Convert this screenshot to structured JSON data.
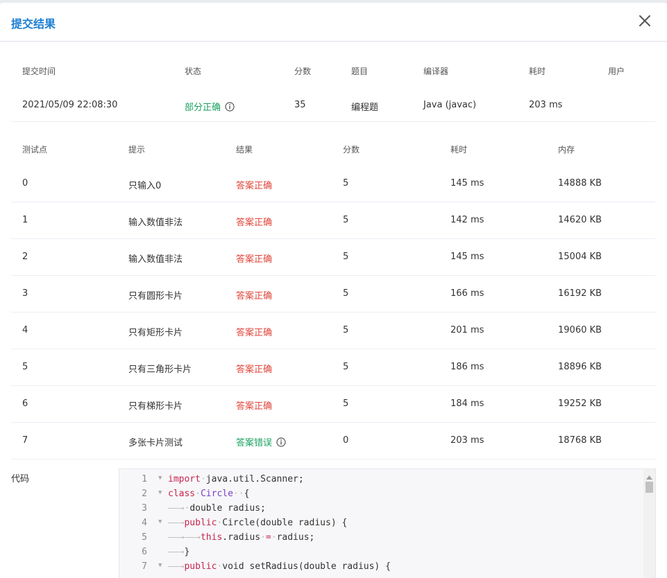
{
  "dialog": {
    "title": "提交结果"
  },
  "summary": {
    "headers": [
      "提交时间",
      "状态",
      "分数",
      "题目",
      "编译器",
      "耗时",
      "用户"
    ],
    "values": {
      "time": "2021/05/09 22:08:30",
      "status": "部分正确",
      "score": "35",
      "problem": "编程题",
      "compiler": "Java (javac)",
      "elapsed": "203 ms"
    }
  },
  "cases": {
    "headers": [
      "测试点",
      "提示",
      "结果",
      "分数",
      "耗时",
      "内存"
    ],
    "rows": [
      {
        "id": "0",
        "hint": "只输入0",
        "result": "答案正确",
        "score": "5",
        "time": "145 ms",
        "mem": "14888 KB"
      },
      {
        "id": "1",
        "hint": "输入数值非法",
        "result": "答案正确",
        "score": "5",
        "time": "142 ms",
        "mem": "14620 KB"
      },
      {
        "id": "2",
        "hint": "输入数值非法",
        "result": "答案正确",
        "score": "5",
        "time": "145 ms",
        "mem": "15004 KB"
      },
      {
        "id": "3",
        "hint": "只有圆形卡片",
        "result": "答案正确",
        "score": "5",
        "time": "166 ms",
        "mem": "16192 KB"
      },
      {
        "id": "4",
        "hint": "只有矩形卡片",
        "result": "答案正确",
        "score": "5",
        "time": "201 ms",
        "mem": "19060 KB"
      },
      {
        "id": "5",
        "hint": "只有三角形卡片",
        "result": "答案正确",
        "score": "5",
        "time": "186 ms",
        "mem": "18896 KB"
      },
      {
        "id": "6",
        "hint": "只有梯形卡片",
        "result": "答案正确",
        "score": "5",
        "time": "184 ms",
        "mem": "19252 KB"
      },
      {
        "id": "7",
        "hint": "多张卡片测试",
        "result": "答案错误",
        "score": "0",
        "time": "203 ms",
        "mem": "18768 KB"
      }
    ]
  },
  "code": {
    "label": "代码",
    "line_numbers": [
      "1",
      "2",
      "3",
      "4",
      "5",
      "6",
      "7"
    ],
    "tokens": {
      "l1_kw": "import",
      "l1_rest": "java.util.Scanner;",
      "l2_kw": "class",
      "l2_cls": "Circle",
      "l2_rest": "{",
      "l3_rest": "double radius;",
      "l4_kw": "public",
      "l4_rest": "Circle(double radius) {",
      "l5_kw": "this",
      "l5_op": "=",
      "l5_rest": ".radius",
      "l5_rest2": "radius;",
      "l6_rest": "}",
      "l7_kw": "public",
      "l7_rest": "void setRadius(double radius) {"
    }
  },
  "colors": {
    "title_blue": "#1e7fd3",
    "status_partial": "#19a15f",
    "answer_correct": "#e0453a",
    "answer_wrong": "#19a15f"
  }
}
